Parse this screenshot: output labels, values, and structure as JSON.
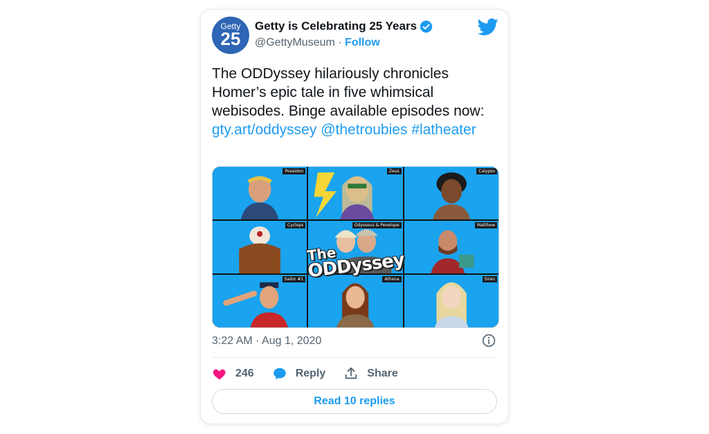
{
  "account": {
    "avatar_small": "Getty",
    "avatar_big": "25",
    "name": "Getty is Celebrating 25 Years",
    "handle": "@GettyMuseum",
    "separator": "·",
    "follow_label": "Follow"
  },
  "tweet": {
    "text": "The ODDyssey hilariously chronicles Homer’s epic tale in five whimsical webisodes. Binge available episodes now: ",
    "link": "gty.art/oddyssey",
    "mention": "@thetroubies",
    "hashtag": "#latheater"
  },
  "media": {
    "tiles": [
      "Poseidon",
      "Zeus",
      "Calypso",
      "Cyclops",
      "Odysseus & Penelope",
      "Matthew",
      "Sailor #1",
      "Athena",
      "Siren"
    ],
    "logo_top": "The",
    "logo_bottom": "ODDyssey"
  },
  "meta": {
    "timestamp": "3:22 AM · Aug 1, 2020"
  },
  "actions": {
    "like_count": "246",
    "reply_label": "Reply",
    "share_label": "Share"
  },
  "read_replies_label": "Read 10 replies",
  "colors": {
    "accent": "#1d9bf0",
    "like": "#f91880",
    "tile_bg": "#1aa3ee"
  }
}
